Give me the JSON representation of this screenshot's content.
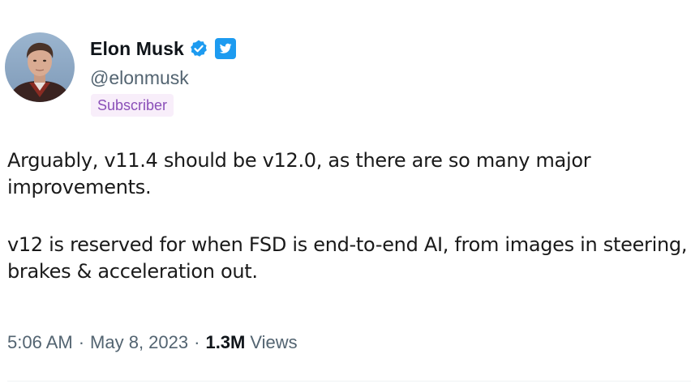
{
  "author": {
    "display_name": "Elon Musk",
    "handle": "@elonmusk",
    "badge": "Subscriber",
    "verified_icon": "blue-check-icon",
    "platform_icon": "twitter-bird-icon"
  },
  "tweet": {
    "paragraphs": [
      "Arguably, v11.4 should be v12.0, as there are so many major improvements.",
      "v12 is reserved for when FSD is end-to-end AI, from images in steering, brakes & acceleration out."
    ],
    "time": "5:06 AM",
    "separator": "·",
    "date": "May 8, 2023",
    "views_count": "1.3M",
    "views_label": "Views"
  },
  "colors": {
    "verified_blue": "#1d9bf0",
    "muted_text": "#536471",
    "subscriber_text": "#8a4fb8",
    "subscriber_bg": "#f8eefa"
  }
}
